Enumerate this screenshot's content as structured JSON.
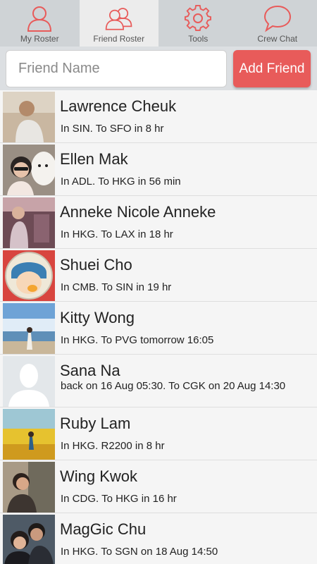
{
  "tabs": [
    {
      "label": "My Roster",
      "icon": "person-icon",
      "active": false
    },
    {
      "label": "Friend Roster",
      "icon": "friends-icon",
      "active": true
    },
    {
      "label": "Tools",
      "icon": "gear-icon",
      "active": false
    },
    {
      "label": "Crew Chat",
      "icon": "chat-bubble-icon",
      "active": false
    }
  ],
  "add_friend": {
    "placeholder": "Friend Name",
    "button_label": "Add Friend"
  },
  "colors": {
    "accent": "#e85b5a",
    "tabbar": "#cfd3d6",
    "active_tab": "#ececec"
  },
  "friends": [
    {
      "name": "Lawrence Cheuk",
      "status": "In SIN.   To SFO in 8 hr"
    },
    {
      "name": "Ellen Mak",
      "status": "In ADL.   To HKG in 56 min"
    },
    {
      "name": "Anneke Nicole Anneke",
      "status": "In HKG.   To LAX in 18 hr"
    },
    {
      "name": "Shuei Cho",
      "status": "In CMB.   To SIN in 19 hr"
    },
    {
      "name": "Kitty Wong",
      "status": "In HKG.   To PVG tomorrow 16:05"
    },
    {
      "name": "Sana Na",
      "status": "back on 16 Aug 05:30.   To CGK on 20 Aug 14:30"
    },
    {
      "name": "Ruby Lam",
      "status": "In HKG. R2200 in 8 hr"
    },
    {
      "name": "Wing Kwok",
      "status": "In CDG.   To HKG in 16 hr"
    },
    {
      "name": "MagGic Chu",
      "status": "In HKG.   To SGN on 18 Aug 14:50"
    }
  ]
}
